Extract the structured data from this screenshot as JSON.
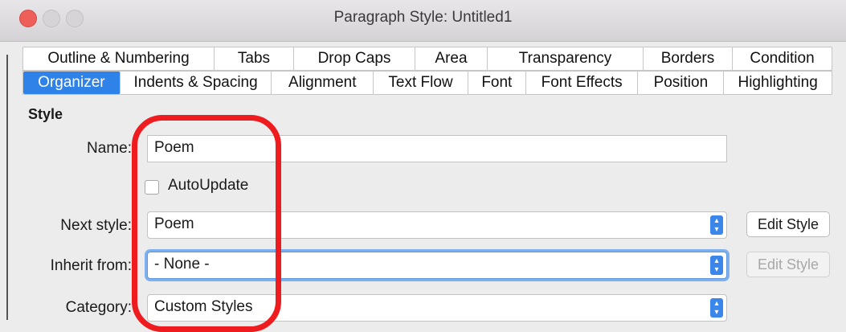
{
  "window": {
    "title": "Paragraph Style: Untitled1"
  },
  "tabs_row1": [
    "Outline & Numbering",
    "Tabs",
    "Drop Caps",
    "Area",
    "Transparency",
    "Borders",
    "Condition"
  ],
  "tabs_row2": [
    "Organizer",
    "Indents & Spacing",
    "Alignment",
    "Text Flow",
    "Font",
    "Font Effects",
    "Position",
    "Highlighting"
  ],
  "active_tab": "Organizer",
  "style_section": {
    "heading": "Style",
    "name_label": "Name:",
    "name_value": "Poem",
    "autoupdate_label": "AutoUpdate",
    "autoupdate_checked": false,
    "next_style_label": "Next style:",
    "next_style_value": "Poem",
    "inherit_label": "Inherit from:",
    "inherit_value": "- None -",
    "category_label": "Category:",
    "category_value": "Custom Styles",
    "edit_style_label": "Edit Style"
  },
  "colors": {
    "accent": "#2f82e7",
    "highlight_annotation": "#ee1b1f",
    "close_button": "#ee5f5a"
  }
}
